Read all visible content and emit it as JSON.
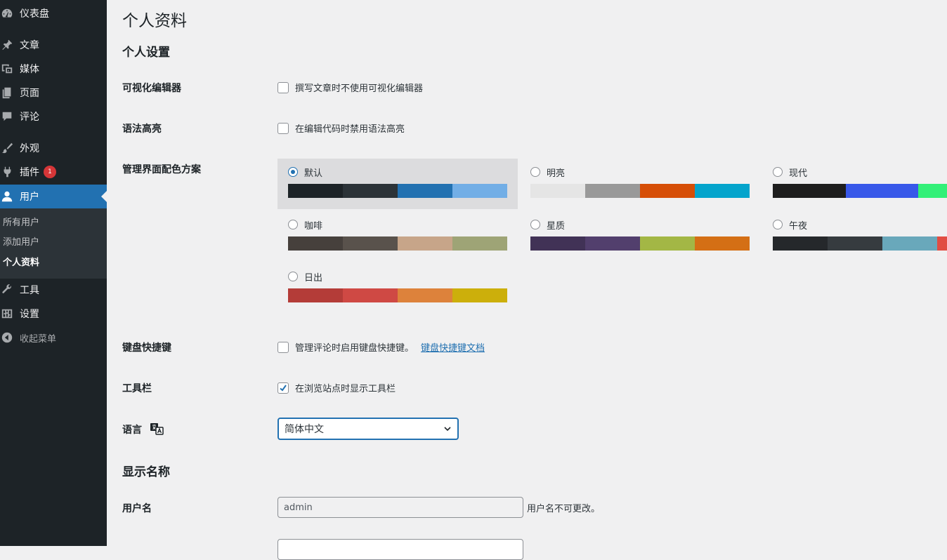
{
  "sidebar": {
    "dashboard": "仪表盘",
    "posts": "文章",
    "media": "媒体",
    "pages": "页面",
    "comments": "评论",
    "appearance": "外观",
    "plugins": "插件",
    "plugins_badge": "1",
    "users": "用户",
    "submenu": {
      "all_users": "所有用户",
      "add_user": "添加用户",
      "profile": "个人资料"
    },
    "tools": "工具",
    "settings": "设置",
    "collapse": "收起菜单"
  },
  "page": {
    "title": "个人资料",
    "personal_settings": "个人设置",
    "visual_editor": {
      "label": "可视化编辑器",
      "text": "撰写文章时不使用可视化编辑器",
      "checked": false
    },
    "syntax": {
      "label": "语法高亮",
      "text": "在编辑代码时禁用语法高亮",
      "checked": false
    },
    "color_scheme": {
      "label": "管理界面配色方案",
      "schemes": [
        {
          "name": "默认",
          "selected": true,
          "colors": [
            "#1d2327",
            "#2c3338",
            "#2271b1",
            "#72aee6"
          ]
        },
        {
          "name": "明亮",
          "selected": false,
          "colors": [
            "#e5e5e5",
            "#999999",
            "#d64e07",
            "#04a4cc"
          ]
        },
        {
          "name": "现代",
          "selected": false,
          "colors": [
            "#1e1e1e",
            "#3858e9",
            "#33f078"
          ]
        },
        {
          "name": "咖啡",
          "selected": false,
          "colors": [
            "#46403c",
            "#59524c",
            "#c7a589",
            "#9ea476"
          ]
        },
        {
          "name": "星质",
          "selected": false,
          "colors": [
            "#413256",
            "#523f6d",
            "#a3b745",
            "#d46f15"
          ]
        },
        {
          "name": "午夜",
          "selected": false,
          "colors": [
            "#25282b",
            "#363b3f",
            "#69a8bb",
            "#e14d43"
          ]
        },
        {
          "name": "日出",
          "selected": false,
          "colors": [
            "#b43c38",
            "#cf4944",
            "#dd823b",
            "#ccaf0b"
          ]
        }
      ]
    },
    "keyboard": {
      "label": "键盘快捷键",
      "text": "管理评论时启用键盘快捷键。",
      "link": "键盘快捷键文档",
      "checked": false
    },
    "toolbar": {
      "label": "工具栏",
      "text": "在浏览站点时显示工具栏",
      "checked": true
    },
    "language": {
      "label": "语言",
      "value": "简体中文"
    },
    "display_name": "显示名称",
    "username": {
      "label": "用户名",
      "value": "admin",
      "hint": "用户名不可更改。"
    }
  }
}
